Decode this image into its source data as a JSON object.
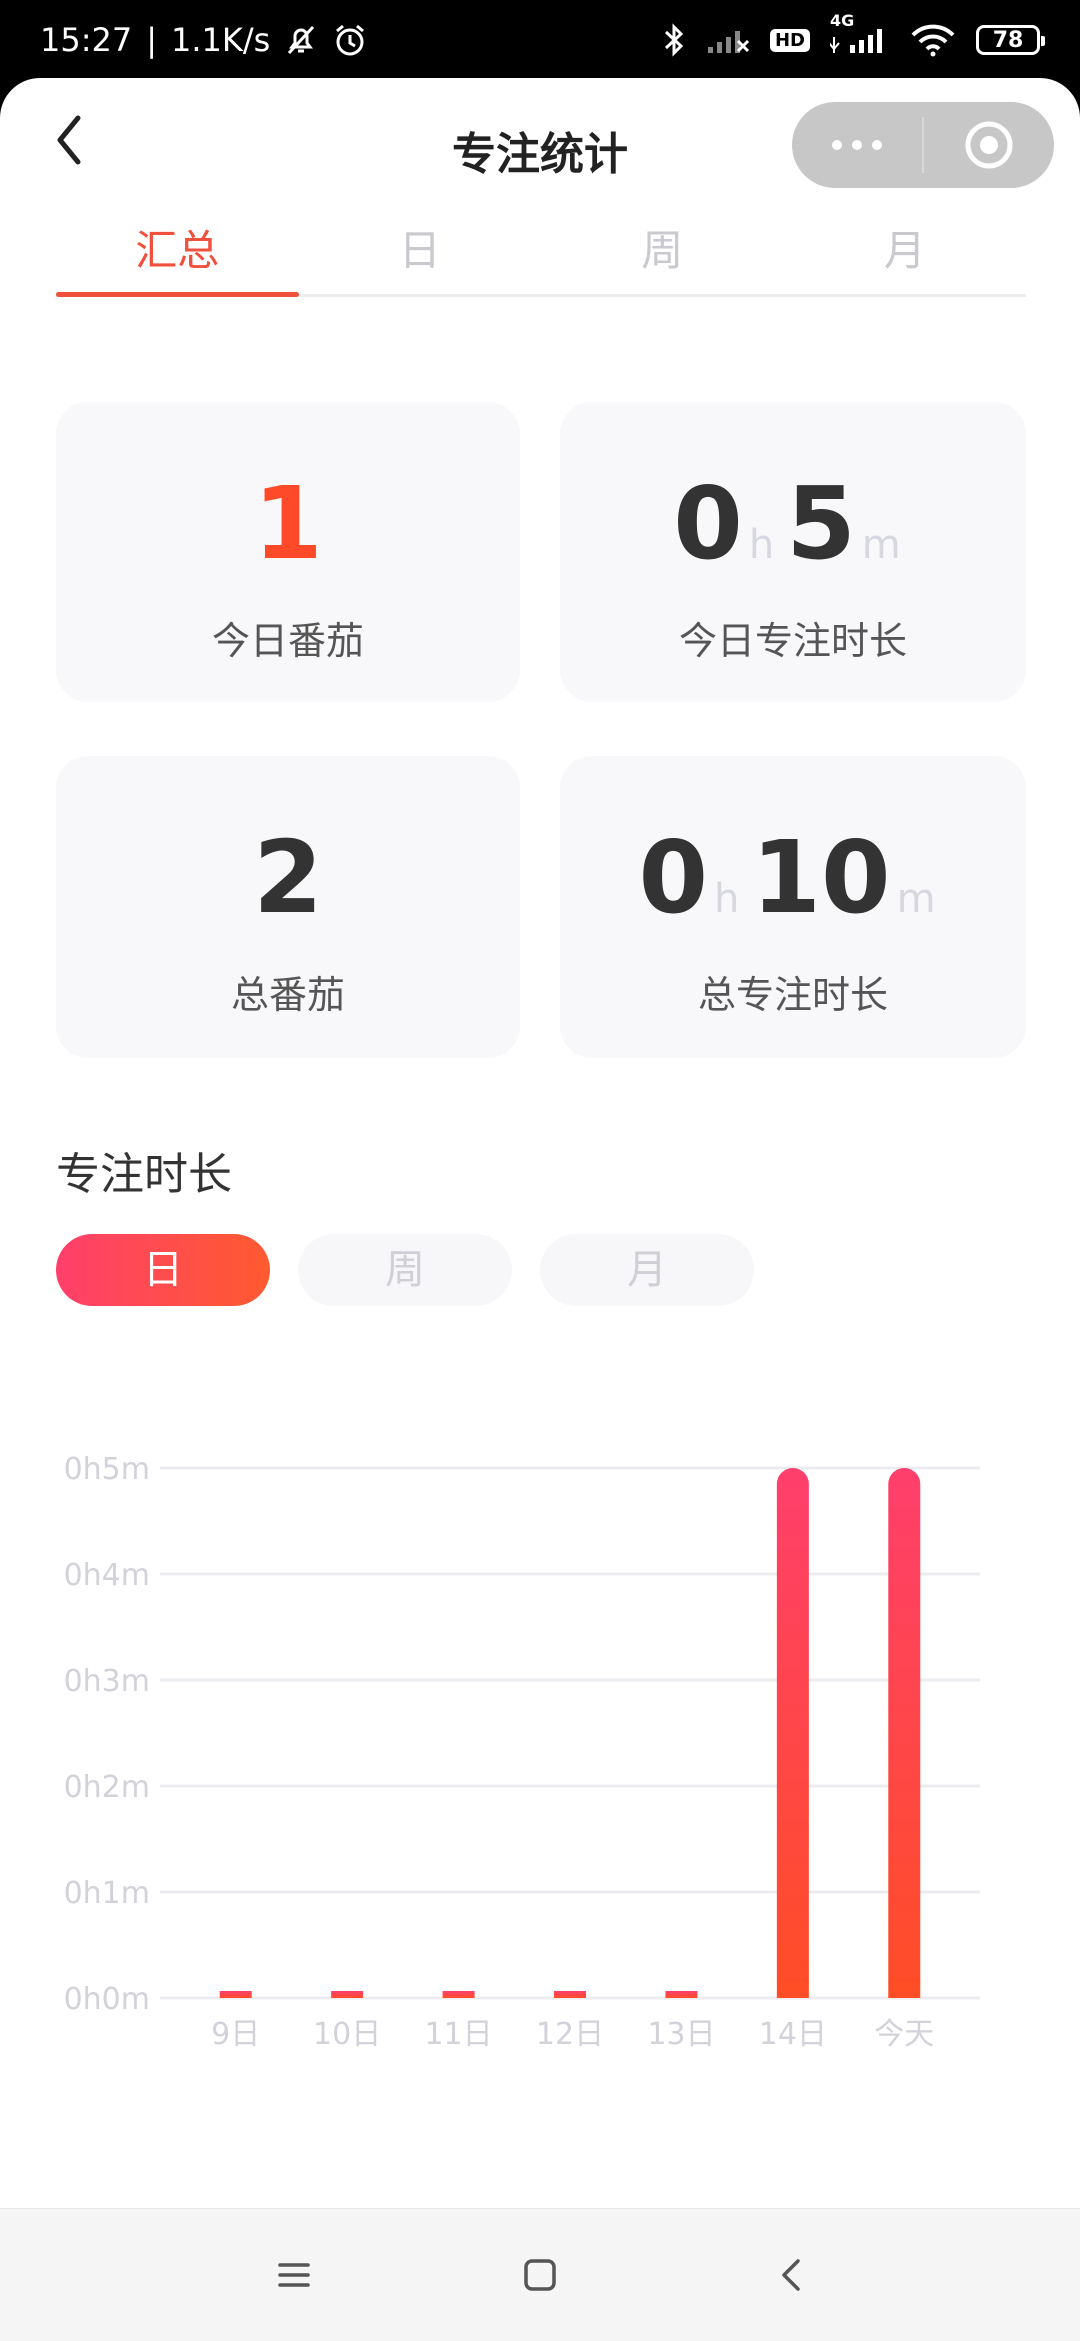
{
  "status_bar": {
    "time": "15:27",
    "network_speed": "1.1K/s",
    "hd_label": "HD",
    "network_type": "4G",
    "battery_level": "78",
    "icons": [
      "bell-off-icon",
      "alarm-icon",
      "bluetooth-icon",
      "signal-crossed-icon",
      "hd-icon",
      "signal-icon",
      "wifi-icon",
      "battery-icon"
    ]
  },
  "header": {
    "title": "专注统计",
    "back_icon": "chevron-left-icon",
    "menu_icon": "more-dots-icon",
    "close_icon": "target-circle-icon"
  },
  "tabs": [
    {
      "label": "汇总",
      "active": true
    },
    {
      "label": "日",
      "active": false
    },
    {
      "label": "周",
      "active": false
    },
    {
      "label": "月",
      "active": false
    }
  ],
  "stats": {
    "today_pomodoro": {
      "value": "1",
      "label": "今日番茄"
    },
    "today_focus": {
      "hours": "0",
      "hour_unit": "h",
      "minutes": "5",
      "minute_unit": "m",
      "label": "今日专注时长"
    },
    "total_pomodoro": {
      "value": "2",
      "label": "总番茄"
    },
    "total_focus": {
      "hours": "0",
      "hour_unit": "h",
      "minutes": "10",
      "minute_unit": "m",
      "label": "总专注时长"
    }
  },
  "section": {
    "title": "专注时长",
    "period_pills": [
      {
        "label": "日",
        "active": true
      },
      {
        "label": "周",
        "active": false
      },
      {
        "label": "月",
        "active": false
      }
    ]
  },
  "colors": {
    "accent": "#f0503c",
    "bar_top": "#ff3f6c",
    "bar_bottom": "#ff4d26"
  },
  "chart_data": {
    "type": "bar",
    "categories": [
      "9日",
      "10日",
      "11日",
      "12日",
      "13日",
      "14日",
      "今天"
    ],
    "values": [
      0,
      0,
      0,
      0,
      0,
      5,
      5
    ],
    "y_ticks": [
      "0h0m",
      "0h1m",
      "0h2m",
      "0h3m",
      "0h4m",
      "0h5m"
    ],
    "ylim": [
      0,
      5
    ],
    "yunit": "minutes",
    "grid": true,
    "title": "",
    "xlabel": "",
    "ylabel": ""
  }
}
